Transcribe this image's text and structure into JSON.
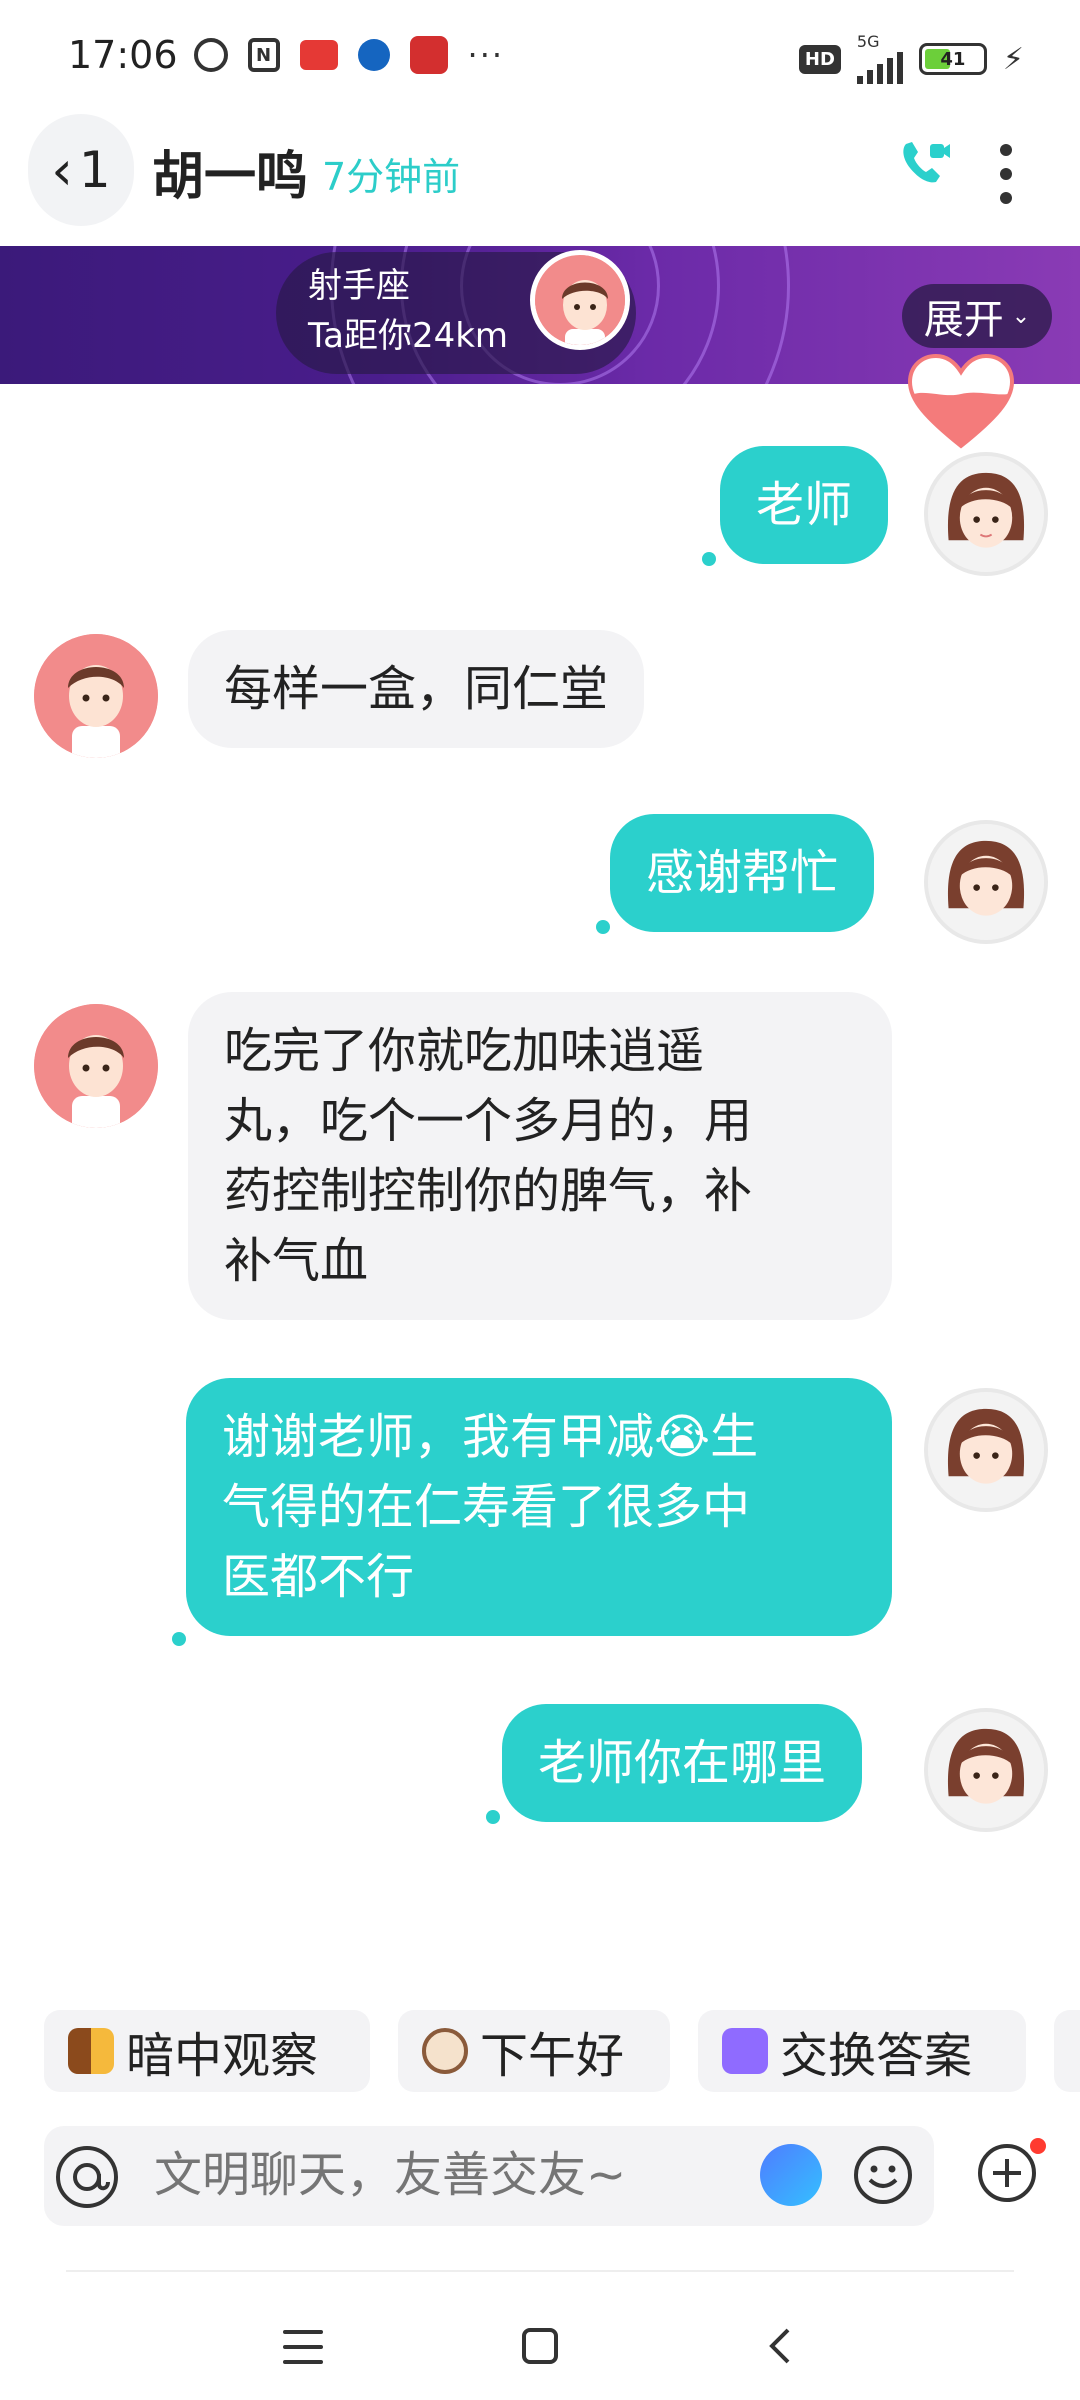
{
  "status_bar": {
    "time": "17:06",
    "icons": [
      "alarm-icon",
      "nfc-icon",
      "news-app-icon",
      "bank-app-icon",
      "shopping-app-icon",
      "more-dots-icon"
    ],
    "network": "5G",
    "hd_label": "HD",
    "battery_level": "41"
  },
  "header": {
    "back_count": "1",
    "contact_name": "胡一鸣",
    "last_seen": "7分钟前"
  },
  "banner": {
    "zodiac": "射手座",
    "distance": "Ta距你24km",
    "expand_label": "展开"
  },
  "messages": [
    {
      "side": "out",
      "text": "老师"
    },
    {
      "side": "in",
      "text": "每样一盒，同仁堂"
    },
    {
      "side": "out",
      "text": "感谢帮忙"
    },
    {
      "side": "in",
      "lines": [
        "吃完了你就吃加味逍遥",
        "丸，吃个一个多月的，用",
        "药控制控制你的脾气，补",
        "补气血"
      ]
    },
    {
      "side": "out",
      "lines": [
        "谢谢老师，我有甲减😭生",
        "气得的在仁寿看了很多中",
        "医都不行"
      ]
    },
    {
      "side": "out",
      "text": "老师你在哪里"
    }
  ],
  "quick_replies": [
    {
      "label": "暗中观察",
      "icon": "peeking-dog-icon"
    },
    {
      "label": "下午好",
      "icon": "coffee-cup-icon"
    },
    {
      "label": "交换答案",
      "icon": "exchange-icon"
    }
  ],
  "input": {
    "placeholder": "文明聊天，友善交友~"
  },
  "colors": {
    "accent": "#2bd0cc",
    "bubble_in": "#f3f3f5",
    "banner_start": "#3b1a7a",
    "banner_end": "#8a3bb5"
  }
}
